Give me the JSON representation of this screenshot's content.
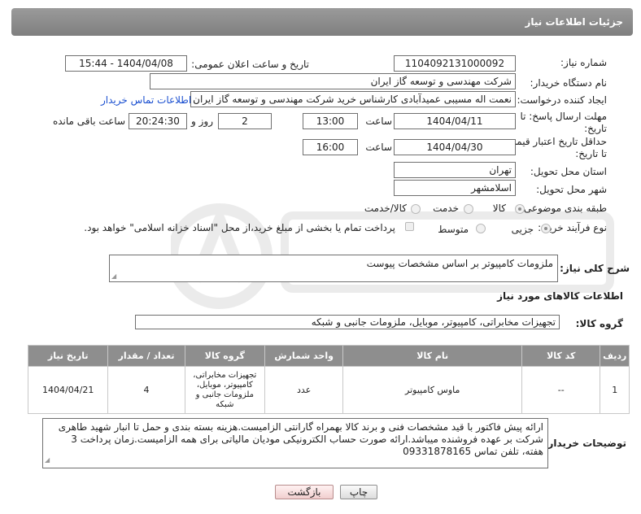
{
  "page_title": "جزئیات اطلاعات نیاز",
  "fields": {
    "need_number_label": "شماره نیاز:",
    "need_number": "1104092131000092",
    "announce_label": "تاریخ و ساعت اعلان عمومی:",
    "announce_value": "1404/04/08 - 15:44",
    "buyer_org_label": "نام دستگاه خریدار:",
    "buyer_org": "شرکت مهندسی و توسعه گاز ایران",
    "requester_label": "ایجاد کننده درخواست:",
    "requester": "نعمت اله مسیبی عمیدآبادی کارشناس خرید شرکت مهندسی و توسعه گاز ایران",
    "buyer_contact_link": "اطلاعات تماس خریدار",
    "reply_deadline_label_1": "مهلت ارسال پاسخ: تا",
    "reply_deadline_label_2": "تاریخ:",
    "reply_date": "1404/04/11",
    "time_label": "ساعت",
    "reply_time": "13:00",
    "days_value": "2",
    "days_label": "روز و",
    "remaining_value": "20:24:30",
    "remaining_label": "ساعت باقی مانده",
    "price_validity_label_1": "حداقل تاریخ اعتبار قیمت:",
    "price_validity_label_2": "تا تاریخ:",
    "price_date": "1404/04/30",
    "price_time": "16:00",
    "province_label": "استان محل تحویل:",
    "province": "تهران",
    "city_label": "شهر محل تحویل:",
    "city": "اسلامشهر",
    "category_label": "طبقه بندی موضوعی:",
    "category_options": [
      "کالا",
      "خدمت",
      "کالا/خدمت"
    ],
    "category_selected": "کالا",
    "process_label": "نوع فرآیند خرید :",
    "process_options": [
      "جزیی",
      "متوسط"
    ],
    "process_selected": "جزیی",
    "payment_note": "پرداخت تمام یا بخشی از مبلغ خرید،از محل \"اسناد خزانه اسلامی\" خواهد بود."
  },
  "description": {
    "label": "شرح کلی نیاز:",
    "value": "ملزومات کامپیوتر بر اساس مشخصات پیوست"
  },
  "goods_section_title": "اطلاعات کالاهای مورد نیاز",
  "goods_group": {
    "label": "گروه کالا:",
    "value": "تجهیزات مخابراتی، کامپیوتر، موبایل، ملزومات جانبی و شبکه"
  },
  "table": {
    "headers": [
      "ردیف",
      "کد کالا",
      "نام کالا",
      "واحد شمارش",
      "گروه کالا",
      "تعداد / مقدار",
      "تاریخ نیاز"
    ],
    "rows": [
      {
        "row": "1",
        "code": "--",
        "name": "ماوس کامپیوتر",
        "unit": "عدد",
        "group": "تجهیزات مخابراتی، کامپیوتر، موبایل، ملزومات جانبی و شبکه",
        "qty": "4",
        "date": "1404/04/21"
      }
    ]
  },
  "buyer_notes": {
    "label": "توضیحات خریدار:",
    "value": "ارائه پیش فاکتور با قید مشخصات فنی و برند کالا بهمراه گارانتی الزامیست.هزینه بسته بندی و حمل تا انبار شهید طاهری شرکت بر عهده فروشنده میباشد.ارائه صورت حساب الکترونیکی مودیان مالیاتی برای همه الزامیست.زمان پرداخت 3 هفته، تلفن تماس 09331878165"
  },
  "buttons": {
    "print": "چاپ",
    "back": "بازگشت"
  }
}
